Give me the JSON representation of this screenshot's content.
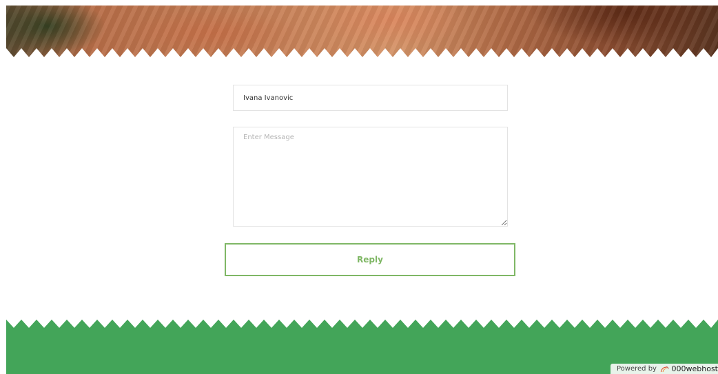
{
  "comment_form": {
    "name_value": "Ivana Ivanovic",
    "message_placeholder": "Enter Message",
    "reply_label": "Reply"
  },
  "badge": {
    "powered_label": "Powered by",
    "brand": "000webhost",
    "icon": "000webhost-logo-icon"
  },
  "colors": {
    "accent_green": "#7fb765",
    "footer_green": "#43a559"
  }
}
